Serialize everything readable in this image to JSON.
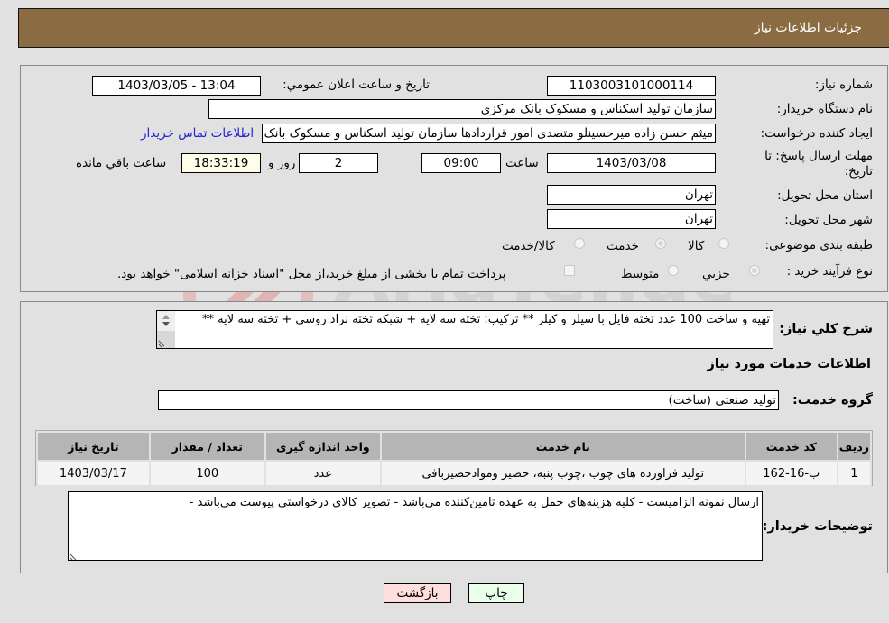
{
  "header": {
    "title": "جزئیات اطلاعات نیاز"
  },
  "form": {
    "need_number": {
      "label": "شماره نیاز:",
      "value": "1103003101000114"
    },
    "announce_datetime": {
      "label": "تاریخ و ساعت اعلان عمومي:",
      "value": "1403/03/05 - 13:04"
    },
    "buyer_org": {
      "label": "نام دستگاه خريدار:",
      "value": "سازمان تولید اسکناس و مسکوک بانک مرکزی"
    },
    "requester": {
      "label": "ایجاد کننده درخواست:",
      "value": "میثم حسن زاده میرحسینلو متصدی امور قراردادها سازمان تولید اسکناس و مسکوک بانک مرکزی",
      "contact_link": "اطلاعات تماس خریدار"
    },
    "deadline": {
      "label_line1": "مهلت ارسال پاسخ: تا",
      "label_line2": "تاریخ:",
      "date": "1403/03/08",
      "time_label": "ساعت",
      "time": "09:00",
      "days": "2",
      "days_label": "روز و",
      "remaining": "18:33:19",
      "remaining_label": "ساعت باقي مانده"
    },
    "province": {
      "label": "استان محل تحویل:",
      "value": "تهران"
    },
    "city": {
      "label": "شهر محل تحویل:",
      "value": "تهران"
    },
    "category": {
      "label": "طبقه بندی موضوعی:",
      "options": [
        "کالا",
        "خدمت",
        "کالا/خدمت"
      ],
      "selected": "خدمت"
    },
    "purchase_type": {
      "label": "نوع فرآیند خرید :",
      "options": [
        "جزيي",
        "متوسط"
      ],
      "selected": "جزيي",
      "treasury_note": "پرداخت تمام یا بخشی از مبلغ خرید،از محل \"اسناد خزانه اسلامی\" خواهد بود."
    }
  },
  "description": {
    "label": "شرح کلي نياز:",
    "value": "تهیه و ساخت 100 عدد تخته فایل با سیلر و کیلر ** ترکیب: تخته سه لایه + شبکه تخته نراد روسی + تخته سه لایه **"
  },
  "services": {
    "section_title": "اطلاعات خدمات مورد نياز",
    "group_label": "گروه خدمت:",
    "group_value": "تولید صنعتی (ساخت)",
    "columns": [
      "رديف",
      "کد خدمت",
      "نام خدمت",
      "واحد اندازه گيری",
      "تعداد / مقدار",
      "تاریخ نیاز"
    ],
    "rows": [
      {
        "row": "1",
        "code": "ب-16-162",
        "name": "تولید فراورده های چوب ،چوب پنبه، حصیر وموادحصیربافی",
        "unit": "عدد",
        "qty": "100",
        "date": "1403/03/17"
      }
    ]
  },
  "buyer_notes": {
    "label": "توضیحات خریدار:",
    "value": "ارسال نمونه الزامیست - کلیه هزینه‌های حمل به عهده تامین‌کننده می‌باشد - تصویر کالای درخواستی پیوست می‌باشد -"
  },
  "buttons": {
    "print": "چاپ",
    "back": "بازگشت"
  },
  "colors": {
    "header_bg": "#8b6c42",
    "link": "#2424d0",
    "print_bg": "#eaffea",
    "back_bg": "#ffdede",
    "remaining_bg": "#fefee8"
  }
}
